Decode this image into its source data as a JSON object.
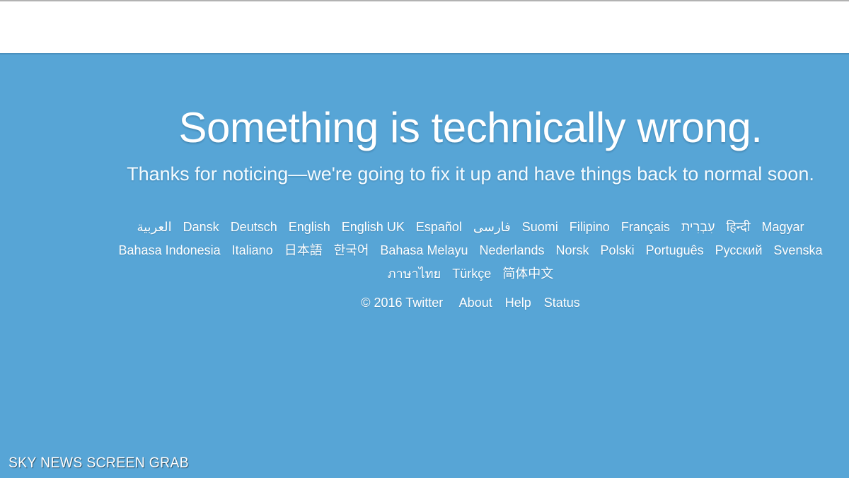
{
  "watermark": {
    "text": "SKY NEWS SCREEN GRAB"
  },
  "page": {
    "headline": "Something is technically wrong.",
    "subhead": "Thanks for noticing—we're going to fix it up and have things back to normal soon.",
    "background_color": "#57a5d6",
    "text_color": "#ffffff"
  },
  "languages": {
    "row1": [
      "العربية",
      "Dansk",
      "Deutsch",
      "English",
      "English UK",
      "Español",
      "فارسی",
      "Suomi",
      "Filipino",
      "Français",
      "עִבְרִית",
      "हिन्दी",
      "Magyar"
    ],
    "row2": [
      "Bahasa Indonesia",
      "Italiano",
      "日本語",
      "한국어",
      "Bahasa Melayu",
      "Nederlands",
      "Norsk",
      "Polski",
      "Português",
      "Русский",
      "Svenska"
    ],
    "row3": [
      "ภาษาไทย",
      "Türkçe",
      "简体中文"
    ]
  },
  "footer": {
    "copyright": "© 2016 Twitter",
    "links": [
      "About",
      "Help",
      "Status"
    ]
  }
}
